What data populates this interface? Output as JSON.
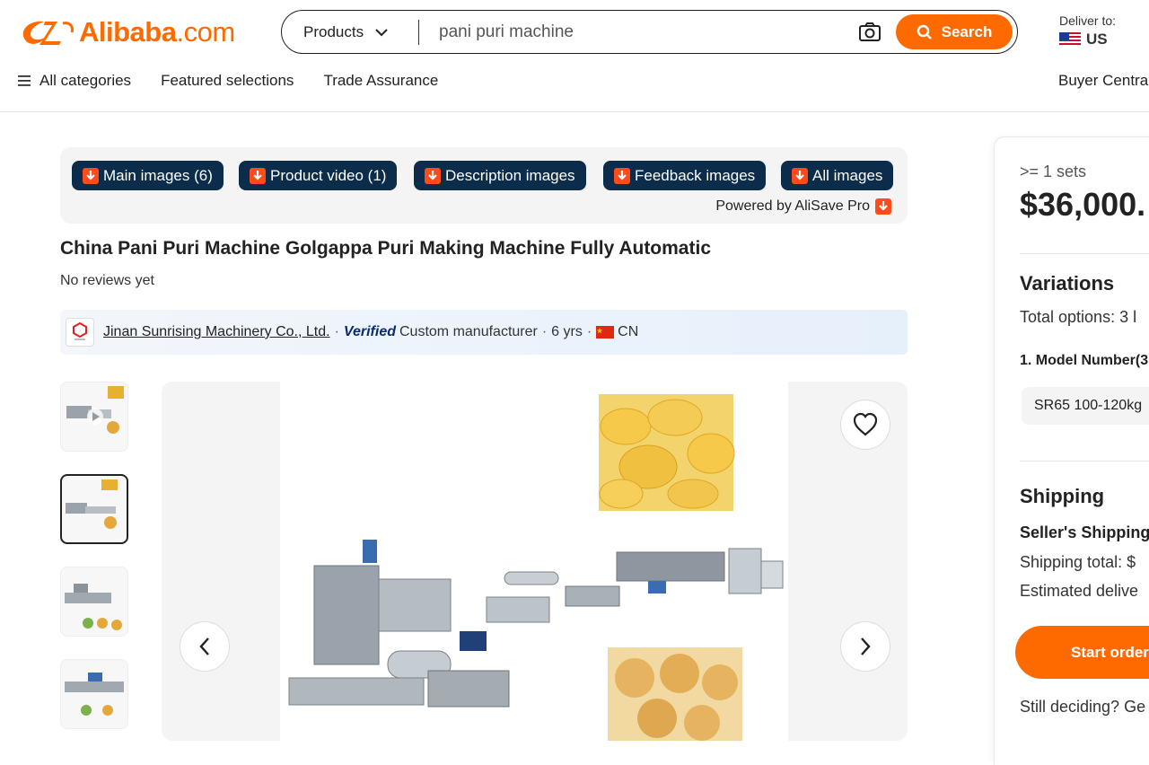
{
  "header": {
    "logo_main": "Alibaba",
    "logo_suffix": ".com",
    "search": {
      "category": "Products",
      "query": "pani puri machine",
      "button_label": "Search"
    },
    "deliver": {
      "label": "Deliver to:",
      "country": "US"
    },
    "nav": {
      "all_categories": "All categories",
      "featured": "Featured selections",
      "trade_assurance": "Trade Assurance",
      "buyer_central": "Buyer Central"
    }
  },
  "toolbar": {
    "buttons": [
      "Main images (6)",
      "Product video (1)",
      "Description images",
      "Feedback images",
      "All images"
    ],
    "powered_by": "Powered by AliSave Pro"
  },
  "product": {
    "title": "China Pani Puri Machine Golgappa Puri Making Machine Fully Automatic",
    "reviews": "No reviews yet"
  },
  "supplier": {
    "name": "Jinan Sunrising Machinery Co., Ltd.",
    "verified": "Verified",
    "type": "Custom manufacturer",
    "years": "6 yrs",
    "country": "CN"
  },
  "panel": {
    "min_order": ">= 1 sets",
    "price": "$36,000.",
    "variations_title": "Variations",
    "total_options": "Total options: 3 l",
    "model_number": "1. Model Number(3",
    "variation_option": "SR65 100-120kg",
    "shipping_title": "Shipping",
    "seller_shipping": "Seller's Shipping",
    "shipping_total": "Shipping total: $",
    "estimated_delivery": "Estimated delive",
    "start_order": "Start order",
    "still_deciding": "Still deciding? Ge"
  },
  "colors": {
    "brand_orange": "#ff6a00",
    "toolbar_button": "#0b2c4a"
  }
}
